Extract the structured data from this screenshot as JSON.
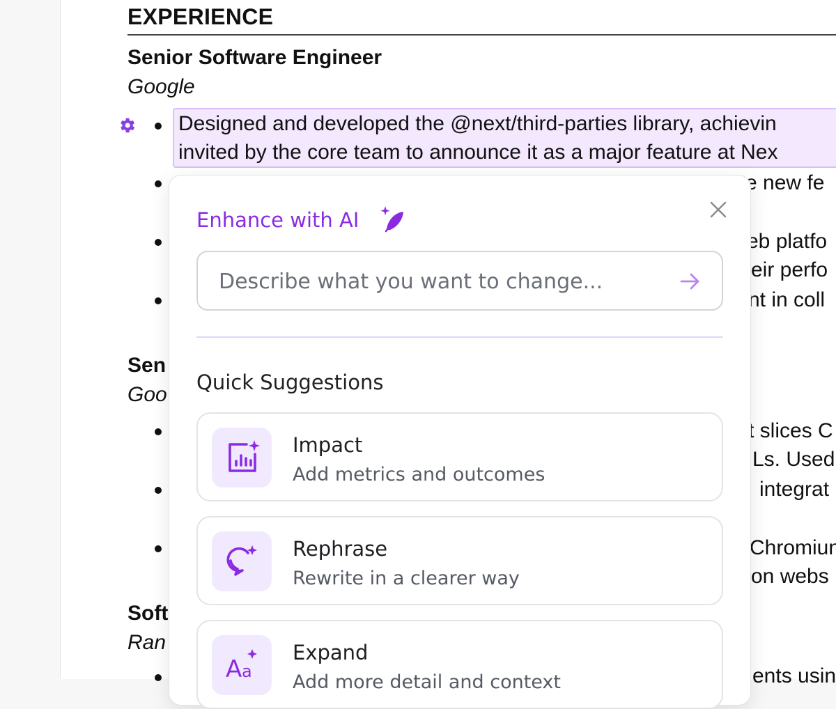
{
  "resume": {
    "section_title": "EXPERIENCE",
    "jobs": [
      {
        "title": "Senior Software Engineer",
        "company": "Google",
        "bullets": [
          "Designed and developed the @next/third-parties library, achievin",
          "invited by the core team to announce it as a major feature at Nex",
          "e new fe",
          "eb platfo",
          "eir perfo",
          "nt in coll"
        ]
      },
      {
        "title": "Sen",
        "company": "Goo",
        "bullets": [
          "t slices C",
          "Ls. Used",
          "integrat",
          "Chromiun",
          "on webs"
        ]
      },
      {
        "title": "Soft",
        "company": "Ran",
        "bullets": [
          "ents usin"
        ]
      }
    ]
  },
  "ai_panel": {
    "title": "Enhance with AI",
    "prompt_placeholder": "Describe what you want to change...",
    "quick_suggestions_title": "Quick Suggestions",
    "suggestions": [
      {
        "label": "Impact",
        "description": "Add metrics and outcomes",
        "icon": "chart-sparkle-icon"
      },
      {
        "label": "Rephrase",
        "description": "Rewrite in a clearer way",
        "icon": "chat-sparkle-icon"
      },
      {
        "label": "Expand",
        "description": "Add more detail and context",
        "icon": "text-size-sparkle-icon"
      }
    ],
    "accent_color": "#8a2be2",
    "icon_bg_color": "#f1e9fe",
    "highlight_bg_color": "#f3e8fd"
  }
}
